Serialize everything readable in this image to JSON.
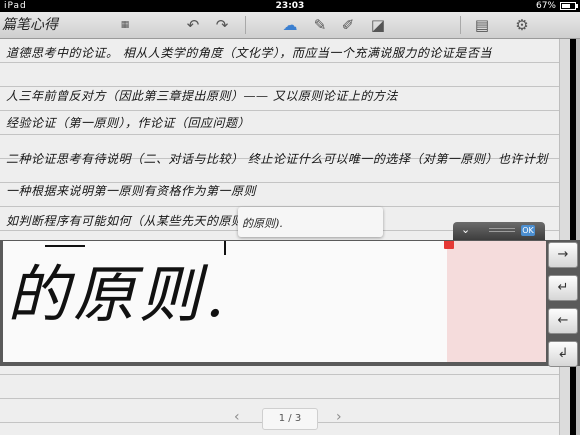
{
  "status": {
    "carrier": "iPad",
    "time": "23:03",
    "battery": "67%",
    "battery_level": 0.67
  },
  "toolbar": {
    "title_strip": "篇笔心得",
    "undo_icon": "↶",
    "redo_icon": "↷",
    "cloud_icon": "☁",
    "pen_icon": "✎",
    "highlighter_icon": "✐",
    "eraser_icon": "◪",
    "pages_icon": "▤",
    "settings_icon": "⚙"
  },
  "note_lines": [
    "道德思考中的论证。  相从人类学的角度（文化学），而应当一个充满说服力的论证是否当",
    "人三年前曾反对方（因此第三章提出原则）—— 又以原则论证上的方法",
    "经验论证（第一原则），作论证（回应问题）",
    "二种论证思考有待说明（二、对话与比较）  终止论证什么可以唯一的选择（对第一原则）也许计划",
    "一种根据来说明第一原则有资格作为第一原则",
    "如判断程序有可能如何（从某些先天的原则）"
  ],
  "popup": {
    "text": "的原则)."
  },
  "panel": {
    "collapse_icon": "⌄",
    "confirm_label": "OK",
    "ink_text": "的原则."
  },
  "side_buttons": [
    {
      "icon": "→",
      "name": "space-right-button"
    },
    {
      "icon": "↵",
      "name": "return-button"
    },
    {
      "icon": "←",
      "name": "backspace-button"
    },
    {
      "icon": "↲",
      "name": "newline-button"
    }
  ],
  "pager": {
    "prev_icon": "‹",
    "next_icon": "›",
    "label": "1 / 3"
  }
}
